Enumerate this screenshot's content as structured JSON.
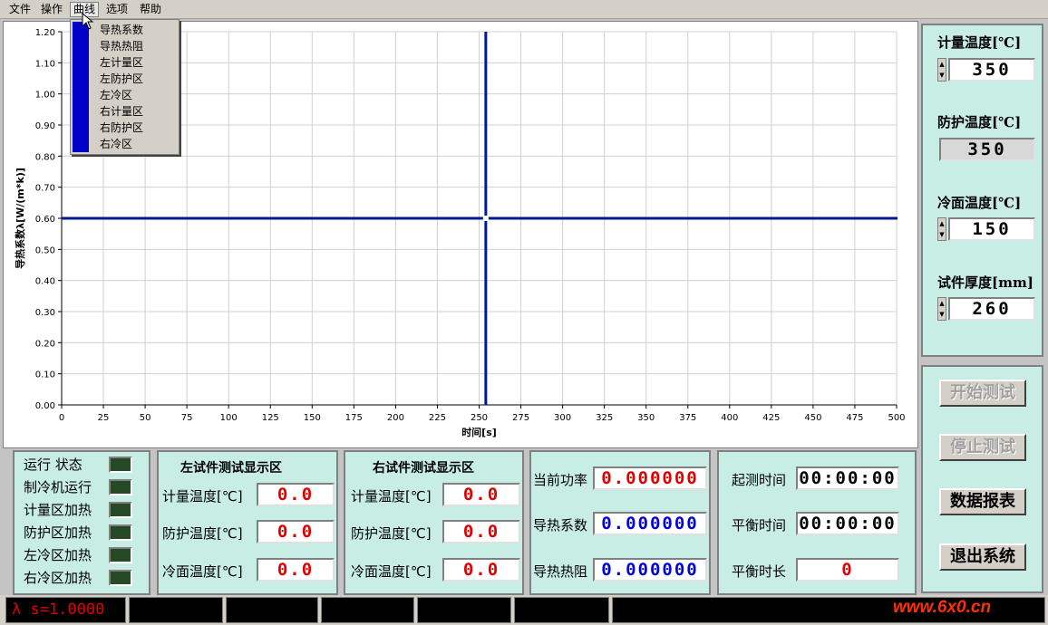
{
  "menu": {
    "file": "文件",
    "operate": "操作",
    "curve": "曲线",
    "options": "选项",
    "help": "帮助"
  },
  "curve_menu": [
    "导热系数",
    "导热热阻",
    "左计量区",
    "左防护区",
    "左冷区",
    "右计量区",
    "右防护区",
    "右冷区"
  ],
  "chart_data": {
    "type": "line",
    "xlabel": "时间[s]",
    "ylabel": "导热系数λ[W/(m*k)]",
    "xlim": [
      0,
      500
    ],
    "ylim": [
      0,
      1.2
    ],
    "x_ticks": [
      0,
      25,
      50,
      75,
      100,
      125,
      150,
      175,
      200,
      225,
      250,
      275,
      300,
      325,
      350,
      375,
      400,
      425,
      450,
      475,
      500
    ],
    "y_ticks": [
      "0.00",
      "0.10",
      "0.20",
      "0.30",
      "0.40",
      "0.50",
      "0.60",
      "0.70",
      "0.80",
      "0.90",
      "1.00",
      "1.10",
      "1.20"
    ],
    "grid": true,
    "cursor": {
      "x": 254,
      "y": 0.6
    },
    "series": []
  },
  "right_panel": {
    "meter_temp_label": "计量温度[℃]",
    "meter_temp": "350",
    "guard_temp_label": "防护温度[℃]",
    "guard_temp": "350",
    "cold_temp_label": "冷面温度[℃]",
    "cold_temp": "150",
    "thickness_label": "试件厚度[mm]",
    "thickness": "260"
  },
  "buttons": {
    "start": "开始测试",
    "stop": "停止测试",
    "report": "数据报表",
    "exit": "退出系统"
  },
  "status_panel": {
    "title": "运行  状态",
    "items": [
      "制冷机运行",
      "计量区加热",
      "防护区加热",
      "左冷区加热",
      "右冷区加热"
    ]
  },
  "left_area": {
    "title": "左试件测试显示区",
    "labels": [
      "计量温度[℃]",
      "防护温度[℃]",
      "冷面温度[℃]"
    ],
    "values": [
      "0.0",
      "0.0",
      "0.0"
    ]
  },
  "right_area": {
    "title": "右试件测试显示区",
    "labels": [
      "计量温度[℃]",
      "防护温度[℃]",
      "冷面温度[℃]"
    ],
    "values": [
      "0.0",
      "0.0",
      "0.0"
    ]
  },
  "readings": {
    "labels": [
      "当前功率",
      "导热系数",
      "导热热阻"
    ],
    "values": [
      "0.000000",
      "0.000000",
      "0.000000"
    ]
  },
  "timing": {
    "labels": [
      "起测时间",
      "平衡时间",
      "平衡时长"
    ],
    "values": [
      "00:00:00",
      "00:00:00",
      "0"
    ]
  },
  "statusbar": {
    "lambda": "λ s=1.0000"
  },
  "watermark": "www.6x0.cn"
}
